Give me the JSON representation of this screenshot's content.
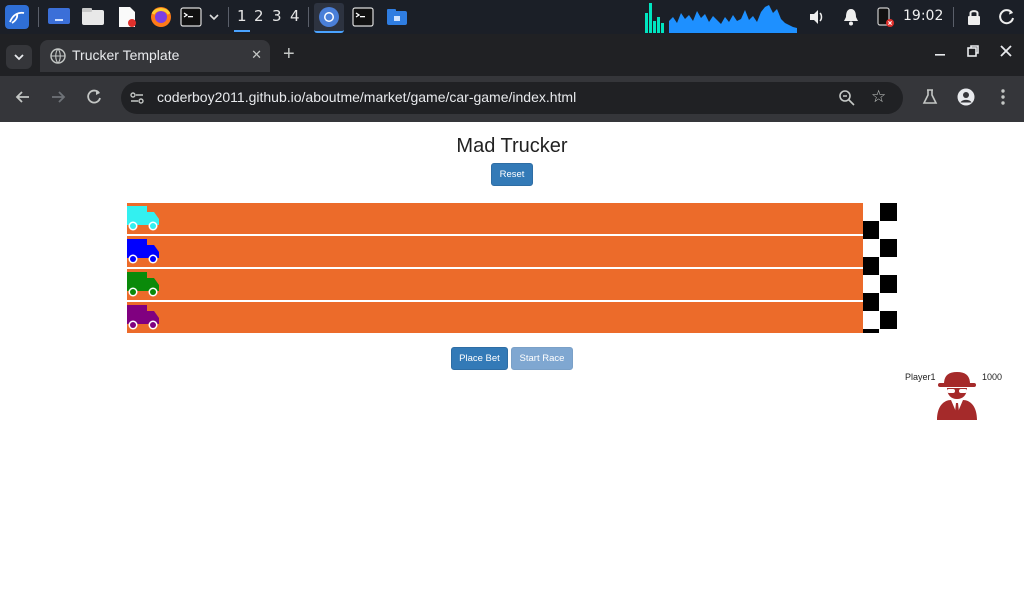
{
  "taskbar": {
    "workspaces": [
      "1",
      "2",
      "3",
      "4"
    ],
    "active_workspace": "1",
    "clock": "19:02",
    "icons": [
      "kali-menu-icon",
      "desktop-icon",
      "file-manager-icon",
      "text-editor-icon",
      "firefox-icon",
      "terminal-icon",
      "chevron-down-icon",
      "chromium-icon",
      "terminal-icon",
      "folder-icon",
      "volume-icon",
      "bell-icon",
      "battery-icon",
      "lock-icon",
      "power-icon"
    ],
    "colors": {
      "background": "#1b1f27",
      "graph": "#1e90ff",
      "graph_peak": "#00e5c0",
      "workspace_active": "#4aa3ff"
    }
  },
  "browser": {
    "tab_title": "Trucker Template",
    "url": "coderboy2011.github.io/aboutme/market/game/car-game/index.html",
    "new_tab_label": "+",
    "tab_close_label": "✕",
    "colors": {
      "frame": "#202124",
      "toolbar": "#35363a",
      "text": "#e8eaed"
    }
  },
  "page": {
    "title": "Mad Trucker",
    "reset_label": "Reset",
    "place_bet_label": "Place Bet",
    "start_race_label": "Start Race",
    "player": {
      "name": "Player1",
      "money": "1000"
    },
    "lanes": [
      {
        "truck_color": "#33f0f0",
        "progress": 0
      },
      {
        "truck_color": "#0000ff",
        "progress": 0
      },
      {
        "truck_color": "#0a8a0a",
        "progress": 0
      },
      {
        "truck_color": "#800080",
        "progress": 0
      }
    ],
    "colors": {
      "lane": "#ec6b2a",
      "button": "#337ab7",
      "button_disabled": "#7fa7d1",
      "avatar": "#a52a2a"
    }
  }
}
